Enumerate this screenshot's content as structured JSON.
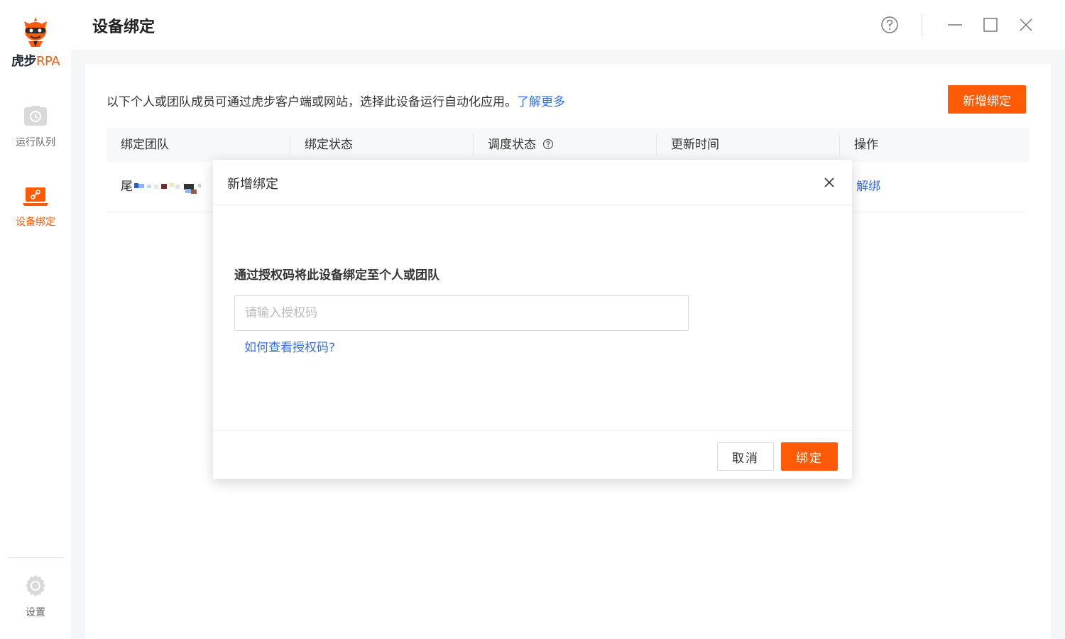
{
  "app": {
    "logo_main": "虎步",
    "logo_suffix": "RPA",
    "brand_color": "#ff5b07",
    "link_color": "#3370e8"
  },
  "sidebar": {
    "items": [
      {
        "label": "运行队列",
        "icon": "clock-icon",
        "active": false
      },
      {
        "label": "设备绑定",
        "icon": "laptop-link-icon",
        "active": true
      }
    ],
    "settings_label": "设置"
  },
  "header": {
    "title": "设备绑定",
    "controls": [
      "help-icon",
      "minimize-icon",
      "maximize-icon",
      "close-icon"
    ]
  },
  "main": {
    "description": "以下个人或团队成员可通过虎步客户端或网站，选择此设备运行自动化应用。",
    "learn_more": "了解更多",
    "add_button": "新增绑定",
    "table": {
      "columns": [
        "绑定团队",
        "绑定状态",
        "调度状态",
        "更新时间",
        "操作"
      ],
      "rows": [
        {
          "team_prefix": "尾",
          "team_masked": true,
          "action": "解绑"
        }
      ]
    }
  },
  "modal": {
    "title": "新增绑定",
    "field_label": "通过授权码将此设备绑定至个人或团队",
    "input_value": "",
    "input_placeholder": "请输入授权码",
    "help_link": "如何查看授权码?",
    "cancel_label": "取消",
    "confirm_label": "绑定"
  }
}
